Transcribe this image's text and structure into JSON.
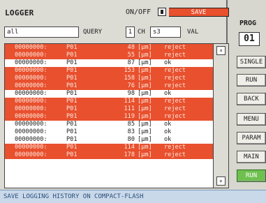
{
  "header": {
    "title": "LOGGER",
    "onoff_label": "ON/OFF",
    "save_label": "SAVE"
  },
  "filters": {
    "query_value": "all",
    "query_label": "QUERY",
    "ch_value": "1",
    "ch_label": "CH",
    "channel_value": "s3",
    "val_label": "VAL"
  },
  "log": {
    "rows": [
      {
        "id": "00000000:",
        "channel": "P01",
        "value": "48",
        "unit": "[µm]",
        "status": "reject"
      },
      {
        "id": "00000000:",
        "channel": "P01",
        "value": "55",
        "unit": "[µm]",
        "status": "reject"
      },
      {
        "id": "00000000:",
        "channel": "P01",
        "value": "87",
        "unit": "[µm]",
        "status": "ok"
      },
      {
        "id": "00000000:",
        "channel": "P01",
        "value": "153",
        "unit": "[µm]",
        "status": "reject"
      },
      {
        "id": "00000000:",
        "channel": "P01",
        "value": "158",
        "unit": "[µm]",
        "status": "reject"
      },
      {
        "id": "00000000:",
        "channel": "P01",
        "value": "76",
        "unit": "[µm]",
        "status": "reject"
      },
      {
        "id": "00000000:",
        "channel": "P01",
        "value": "98",
        "unit": "[µm]",
        "status": "ok"
      },
      {
        "id": "00000000:",
        "channel": "P01",
        "value": "114",
        "unit": "[µm]",
        "status": "reject"
      },
      {
        "id": "00000000:",
        "channel": "P01",
        "value": "111",
        "unit": "[µm]",
        "status": "reject"
      },
      {
        "id": "00000000:",
        "channel": "P01",
        "value": "119",
        "unit": "[µm]",
        "status": "reject"
      },
      {
        "id": "00000000:",
        "channel": "P01",
        "value": "85",
        "unit": "[µm]",
        "status": "ok"
      },
      {
        "id": "00000000:",
        "channel": "P01",
        "value": "83",
        "unit": "[µm]",
        "status": "ok"
      },
      {
        "id": "00000000:",
        "channel": "P01",
        "value": "80",
        "unit": "[µm]",
        "status": "ok"
      },
      {
        "id": "00000000:",
        "channel": "P01",
        "value": "114",
        "unit": "[µm]",
        "status": "reject"
      },
      {
        "id": "00000000:",
        "channel": "P01",
        "value": "178",
        "unit": "[µm]",
        "status": "reject"
      }
    ],
    "scroll_up_icon": "chevron-up-double-icon",
    "scroll_down_icon": "chevron-down-double-icon",
    "scroll_up_glyph": "»",
    "scroll_down_glyph": "»"
  },
  "sidebar": {
    "prog_label": "PROG",
    "prog_value": "01",
    "buttons": [
      {
        "label": "SINGLE",
        "active": false
      },
      {
        "label": "RUN",
        "active": false
      },
      {
        "label": "BACK",
        "active": false
      },
      {
        "label": "MENU",
        "active": false
      },
      {
        "label": "PARAM",
        "active": false
      },
      {
        "label": "MAIN",
        "active": false
      },
      {
        "label": "RUN",
        "active": true
      }
    ]
  },
  "status_bar": {
    "text": "SAVE LOGGING HISTORY ON COMPACT-FLASH"
  },
  "colors": {
    "reject_row": "#e8502e",
    "ok_row": "#ffffff",
    "run_active": "#6fc04f",
    "status_bar": "#c9d9ea"
  }
}
